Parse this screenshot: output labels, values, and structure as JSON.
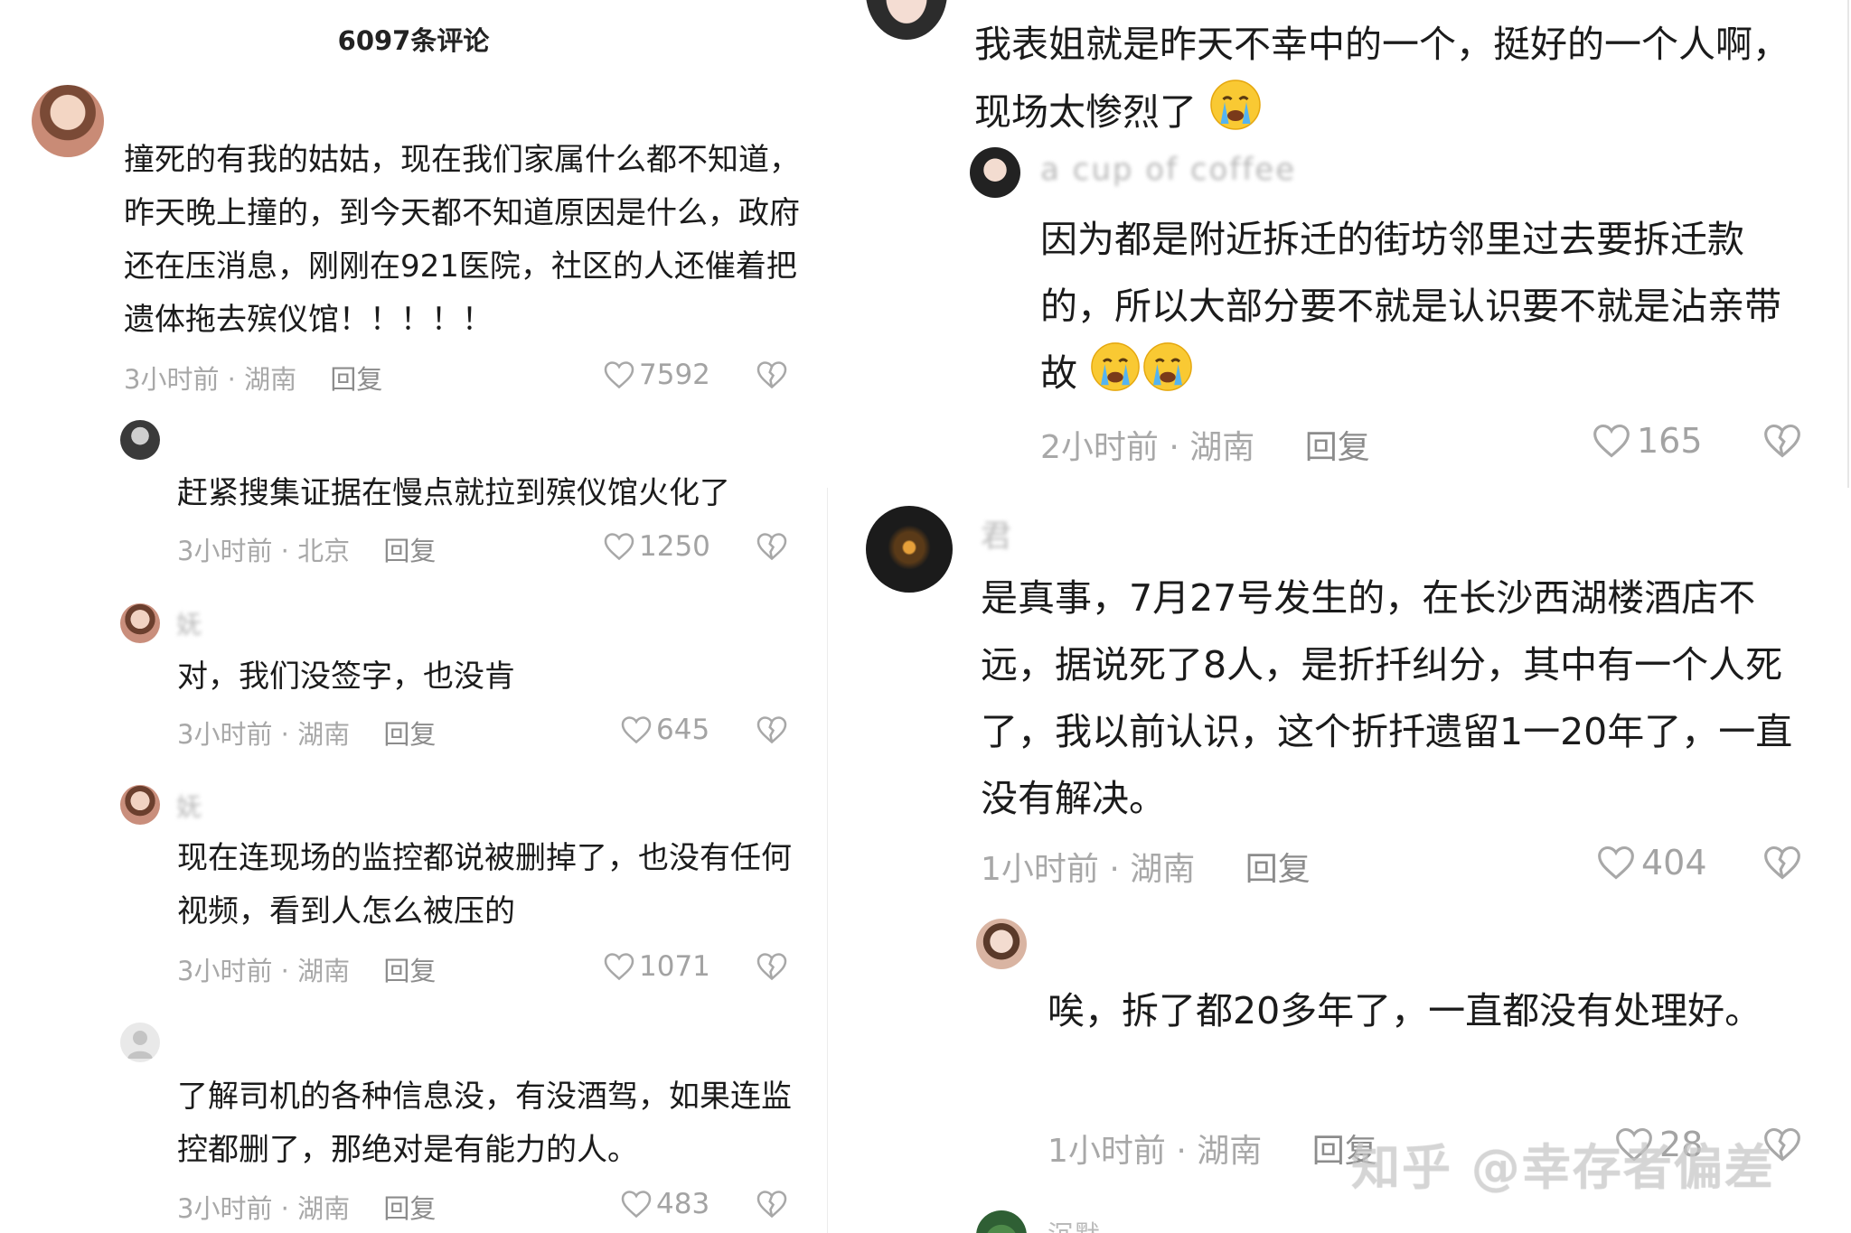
{
  "header": {
    "comment_count": "6097条评论"
  },
  "left": [
    {
      "name": "",
      "text": "撞死的有我的姑姑，现在我们家属什么都不知道，昨天晚上撞的，到今天都不知道原因是什么，政府还在压消息，刚刚在921医院，社区的人还催着把遗体拖去殡仪馆！！！！！",
      "time": "3小时前 · 湖南",
      "reply": "回复",
      "likes": "7592"
    },
    {
      "name": "",
      "text": "赶紧搜集证据在慢点就拉到殡仪馆火化了",
      "time": "3小时前 · 北京",
      "reply": "回复",
      "likes": "1250"
    },
    {
      "name": "妩",
      "text": "对，我们没签字，也没肯",
      "time": "3小时前 · 湖南",
      "reply": "回复",
      "likes": "645"
    },
    {
      "name": "妩",
      "text": "现在连现场的监控都说被删掉了，也没有任何视频，看到人怎么被压的",
      "time": "3小时前 · 湖南",
      "reply": "回复",
      "likes": "1071"
    },
    {
      "name": "",
      "text": "了解司机的各种信息没，有没酒驾，如果连监控都删了，那绝对是有能力的人。",
      "time": "3小时前 · 湖南",
      "reply": "回复",
      "likes": "483"
    }
  ],
  "right": [
    {
      "name": "",
      "text": "我表姐就是昨天不幸中的一个，挺好的一个人啊，现场太惨烈了",
      "emoji": "crying-face"
    },
    {
      "name": "a cup of coffee",
      "text": "因为都是附近拆迁的街坊邻里过去要拆迁款的，所以大部分要不就是认识要不就是沾亲带故",
      "emoji": "crying-face",
      "time": "2小时前 · 湖南",
      "reply": "回复",
      "likes": "165"
    },
    {
      "name": "君",
      "text": "是真事，7月27号发生的，在长沙西湖楼酒店不远，据说死了8人，是折扦纠分，其中有一个人死了，我以前认识，这个折扦遗留1一20年了，一直没有解决。",
      "time": "1小时前 · 湖南",
      "reply": "回复",
      "likes": "404"
    },
    {
      "name": "",
      "text": "唉，拆了都20多年了，一直都没有处理好。",
      "time": "1小时前 · 湖南",
      "reply": "回复",
      "likes": "28"
    },
    {
      "name": "沉默"
    }
  ],
  "watermark": "知乎 @幸存者偏差",
  "colors": {
    "text": "#1b1b1b",
    "meta": "#a8a8a8",
    "like": "#a3a3a3",
    "background": "#ffffff"
  }
}
